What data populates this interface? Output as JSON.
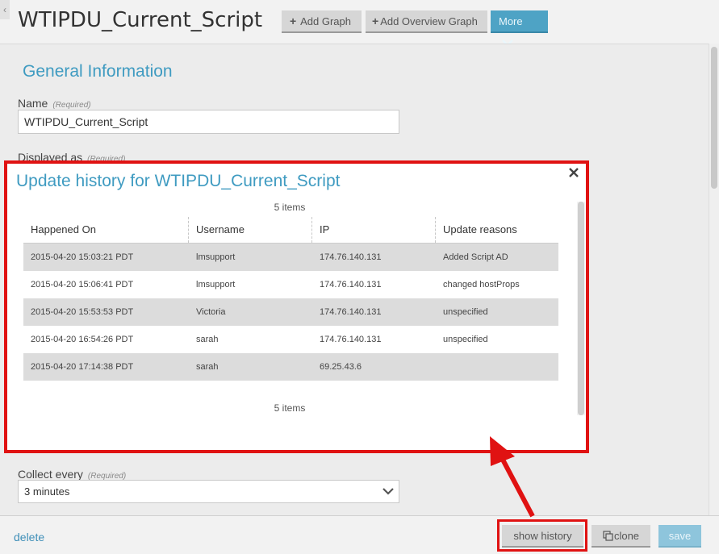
{
  "header": {
    "collapse_glyph": "‹",
    "title": "WTIPDU_Current_Script",
    "add_graph_label": "Add Graph",
    "add_overview_label": "Add Overview Graph",
    "more_label": "More"
  },
  "form": {
    "section_title": "General Information",
    "name_label": "Name",
    "name_required": "(Required)",
    "name_value": "WTIPDU_Current_Script",
    "displayed_label": "Displayed as",
    "displayed_required": "(Required)",
    "collect_label": "Collect every",
    "collect_required": "(Required)",
    "collect_value": "3 minutes"
  },
  "modal": {
    "title": "Update history for WTIPDU_Current_Script",
    "count_top": "5 items",
    "count_bottom": "5 items",
    "columns": [
      "Happened On",
      "Username",
      "IP",
      "Update reasons"
    ],
    "rows": [
      [
        "2015-04-20 15:03:21 PDT",
        "lmsupport",
        "174.76.140.131",
        "Added Script AD"
      ],
      [
        "2015-04-20 15:06:41 PDT",
        "lmsupport",
        "174.76.140.131",
        "changed hostProps"
      ],
      [
        "2015-04-20 15:53:53 PDT",
        "Victoria",
        "174.76.140.131",
        "unspecified"
      ],
      [
        "2015-04-20 16:54:26 PDT",
        "sarah",
        "174.76.140.131",
        "unspecified"
      ],
      [
        "2015-04-20 17:14:38 PDT",
        "sarah",
        "69.25.43.6",
        ""
      ]
    ]
  },
  "footer": {
    "delete_label": "delete",
    "history_label": "show history",
    "clone_label": "clone",
    "save_label": "save"
  },
  "colors": {
    "accent": "#3f9bc1",
    "highlight": "#e01212",
    "more_button": "#4ea3c5"
  }
}
